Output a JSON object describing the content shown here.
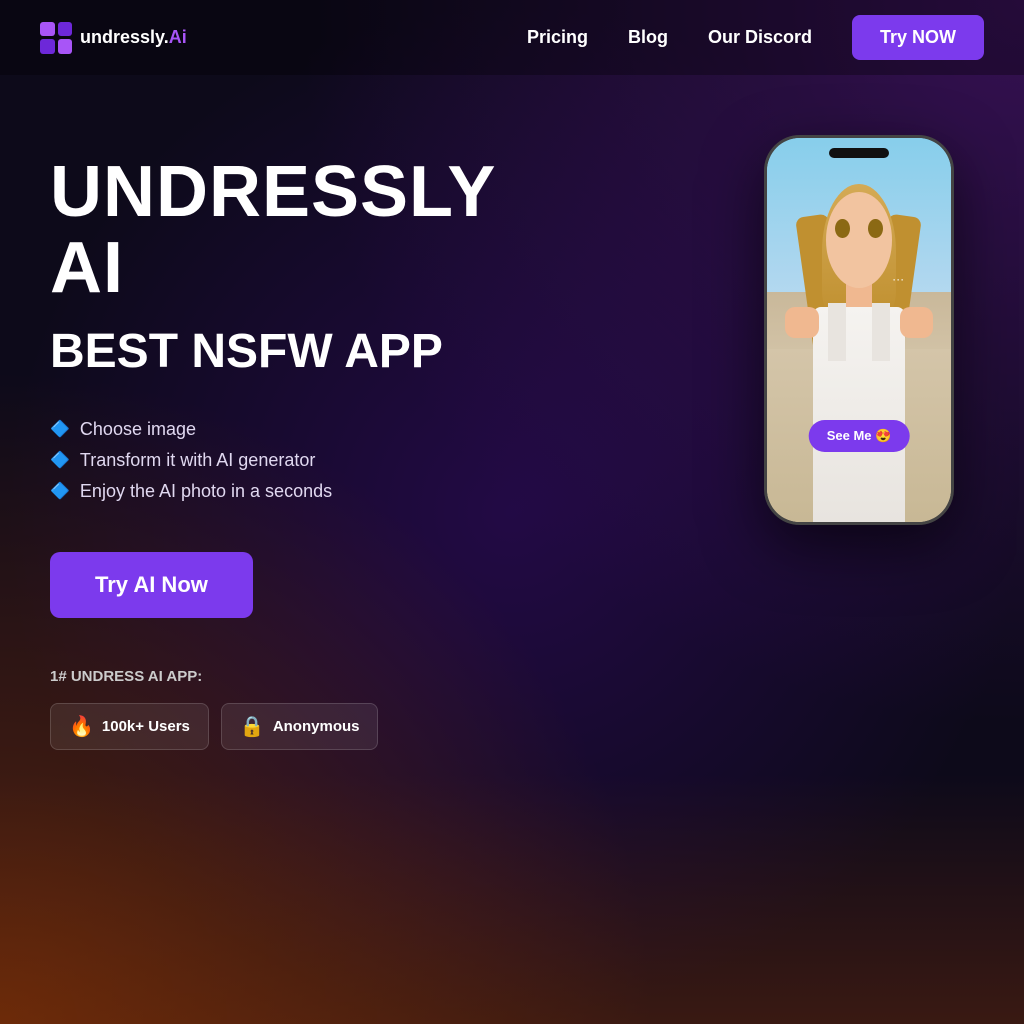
{
  "nav": {
    "logo_text": "undressly.",
    "logo_ai": "Ai",
    "links": [
      {
        "label": "Pricing",
        "id": "pricing"
      },
      {
        "label": "Blog",
        "id": "blog"
      },
      {
        "label": "Our Discord",
        "id": "discord"
      }
    ],
    "try_btn": "Try NOW"
  },
  "hero": {
    "title": "UNDRESSLY AI",
    "subtitle": "BEST NSFW APP",
    "features": [
      "🔷 Choose image",
      "🔷 Transform it with AI generator",
      "🔷 Enjoy the AI photo in a seconds"
    ],
    "cta_label": "Try AI Now"
  },
  "stats_label": "1# UNDRESS AI APP:",
  "badges": [
    {
      "icon": "🔥",
      "text": "100k+ Users"
    },
    {
      "icon": "🔒",
      "text": "Anonymous"
    }
  ],
  "phone": {
    "see_me_label": "See Me 😍"
  }
}
